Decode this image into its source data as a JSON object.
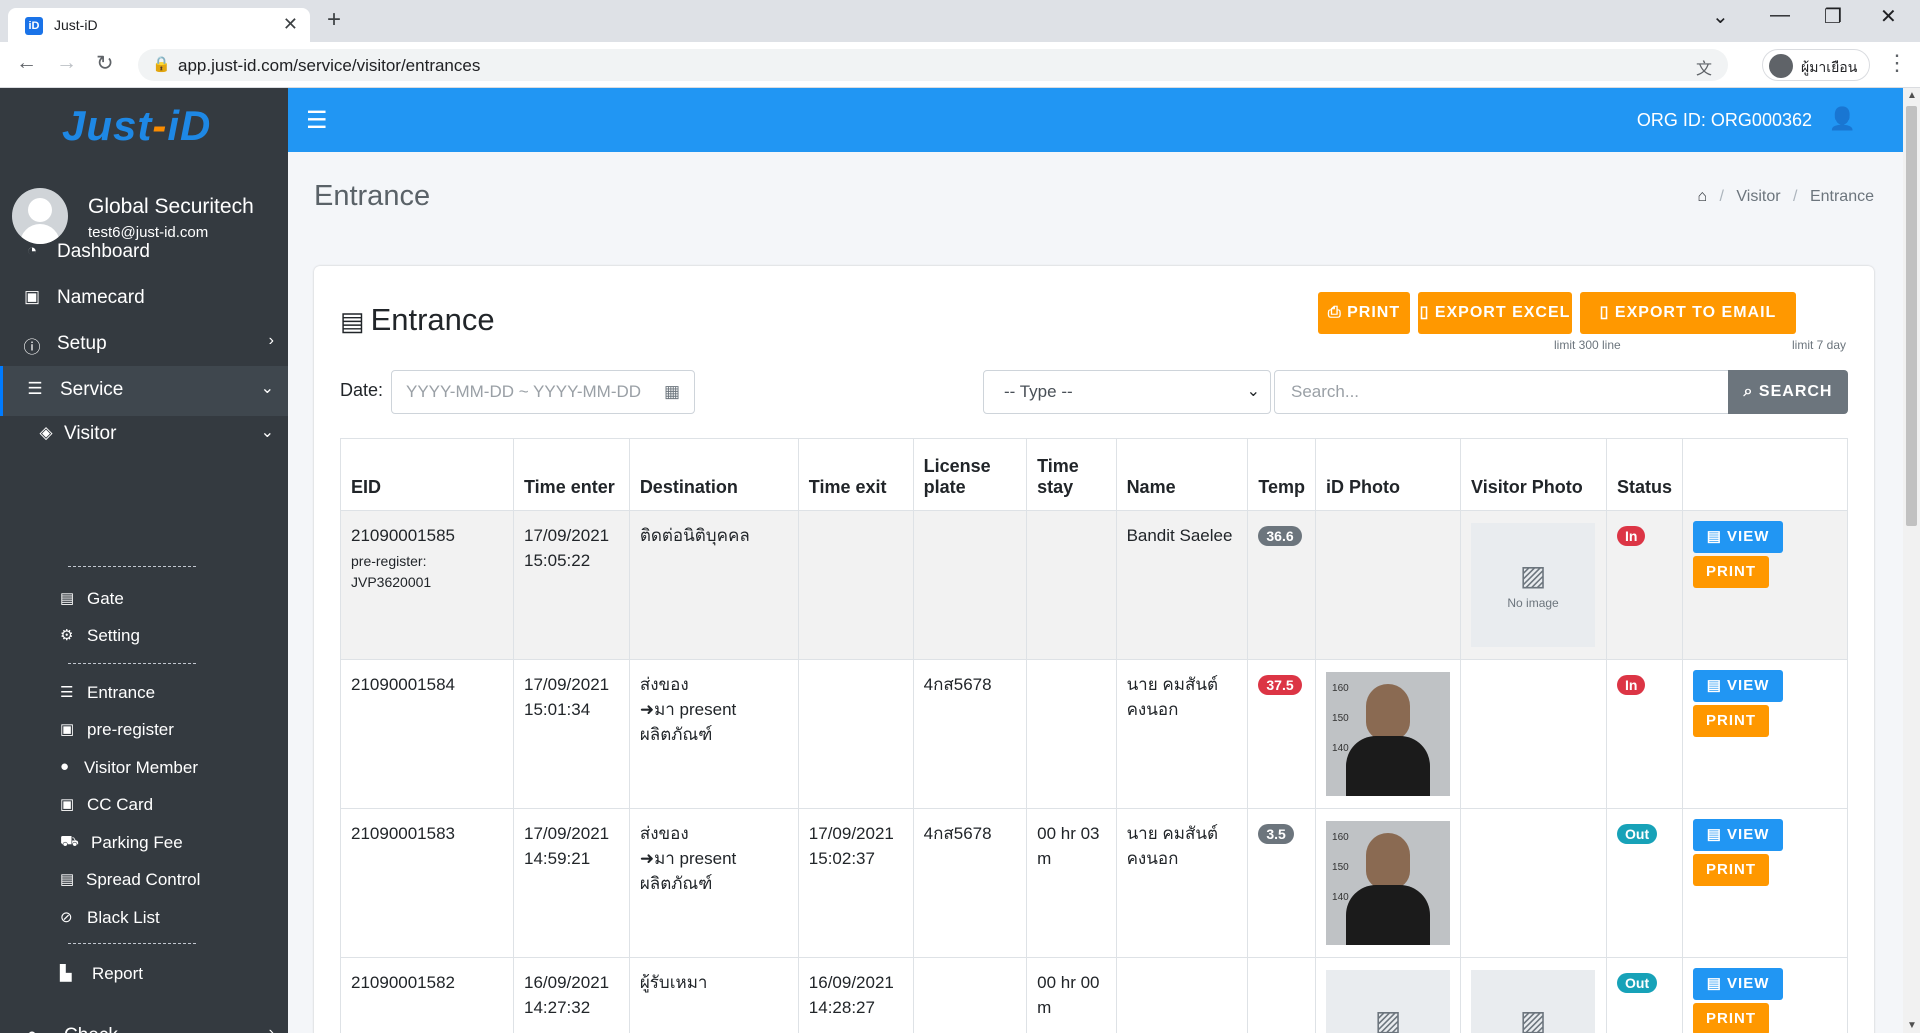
{
  "browser": {
    "tab_title": "Just-iD",
    "url": "app.just-id.com/service/visitor/entrances",
    "profile_name": "ผู้มาเยือน"
  },
  "sidebar": {
    "logo_main": "Just",
    "logo_dash": "-",
    "logo_end": "iD",
    "user_name": "Global Securitech",
    "user_email": "test6@just-id.com",
    "items": [
      {
        "label": "Dashboard",
        "icon": "dashboard-icon"
      },
      {
        "label": "Namecard",
        "icon": "id-card-icon"
      },
      {
        "label": "Setup",
        "icon": "info-icon"
      },
      {
        "label": "Service",
        "icon": "list-icon"
      },
      {
        "label": "Visitor",
        "icon": "tag-icon"
      }
    ],
    "sub_items": [
      {
        "label": "Gate",
        "icon": "gate-icon"
      },
      {
        "label": "Setting",
        "icon": "gear-icon"
      },
      {
        "label": "Entrance",
        "icon": "list-icon"
      },
      {
        "label": "pre-register",
        "icon": "id-card-icon"
      },
      {
        "label": "Visitor Member",
        "icon": "user-icon"
      },
      {
        "label": "CC Card",
        "icon": "id-card-icon"
      },
      {
        "label": "Parking Fee",
        "icon": "car-icon"
      },
      {
        "label": "Spread Control",
        "icon": "gate-icon"
      },
      {
        "label": "Black List",
        "icon": "ban-icon"
      },
      {
        "label": "Report",
        "icon": "chart-icon"
      }
    ],
    "truncated_item": "Check"
  },
  "topnav": {
    "org_id": "ORG ID: ORG000362"
  },
  "page": {
    "title": "Entrance",
    "breadcrumb": [
      "Visitor",
      "Entrance"
    ]
  },
  "card": {
    "title": "Entrance",
    "print_label": "PRINT",
    "export_excel_label": "EXPORT EXCEL",
    "export_excel_limit": "limit 300 line",
    "export_email_label": "EXPORT TO EMAIL",
    "export_email_limit": "limit 7 day",
    "date_label": "Date:",
    "date_placeholder": "YYYY-MM-DD ~ YYYY-MM-DD",
    "type_value": "-- Type --",
    "search_placeholder": "Search...",
    "search_label": "SEARCH"
  },
  "table": {
    "headers": [
      "EID",
      "Time enter",
      "Destination",
      "Time exit",
      "License plate",
      "Time stay",
      "Name",
      "Temp",
      "iD Photo",
      "Visitor Photo",
      "Status",
      ""
    ],
    "header_license_1": "License",
    "header_license_2": "plate",
    "header_stay_1": "Time",
    "header_stay_2": "stay",
    "view_label": "VIEW",
    "print_label": "PRINT",
    "no_image_label": "No image",
    "rows": [
      {
        "eid": "21090001585",
        "pre_label": "pre-register:",
        "pre_code": "JVP3620001",
        "enter_date": "17/09/2021",
        "enter_time": "15:05:22",
        "dest_1": "ติดต่อนิติบุคคล",
        "dest_2": "",
        "dest_3": "",
        "exit_date": "",
        "exit_time": "",
        "plate": "",
        "stay_1": "",
        "stay_2": "",
        "name": "Bandit Saelee",
        "temp": "36.6",
        "status": "In"
      },
      {
        "eid": "21090001584",
        "enter_date": "17/09/2021",
        "enter_time": "15:01:34",
        "dest_1": "ส่งของ",
        "dest_2": "มา present",
        "dest_3": "ผลิตภัณฑ์",
        "exit_date": "",
        "exit_time": "",
        "plate": "4กส5678",
        "stay_1": "",
        "stay_2": "",
        "name": "นาย คมสันต์ คงนอก",
        "temp": "37.5",
        "status": "In"
      },
      {
        "eid": "21090001583",
        "enter_date": "17/09/2021",
        "enter_time": "14:59:21",
        "dest_1": "ส่งของ",
        "dest_2": "มา present",
        "dest_3": "ผลิตภัณฑ์",
        "exit_date": "17/09/2021",
        "exit_time": "15:02:37",
        "plate": "4กส5678",
        "stay_1": "00 hr 03",
        "stay_2": "m",
        "name": "นาย คมสันต์ คงนอก",
        "temp": "3.5",
        "status": "Out"
      },
      {
        "eid": "21090001582",
        "enter_date": "16/09/2021",
        "enter_time": "14:27:32",
        "dest_1": "ผู้รับเหมา",
        "dest_2": "",
        "dest_3": "",
        "exit_date": "16/09/2021",
        "exit_time": "14:28:27",
        "plate": "",
        "stay_1": "00 hr 00",
        "stay_2": "m",
        "name": "",
        "temp": "",
        "status": "Out"
      }
    ]
  },
  "colors": {
    "navbar": "#2196f3",
    "sidebar": "#343a40",
    "accent_orange": "#ff9800",
    "badge_in": "#dc3545",
    "badge_out": "#17a2b8"
  }
}
